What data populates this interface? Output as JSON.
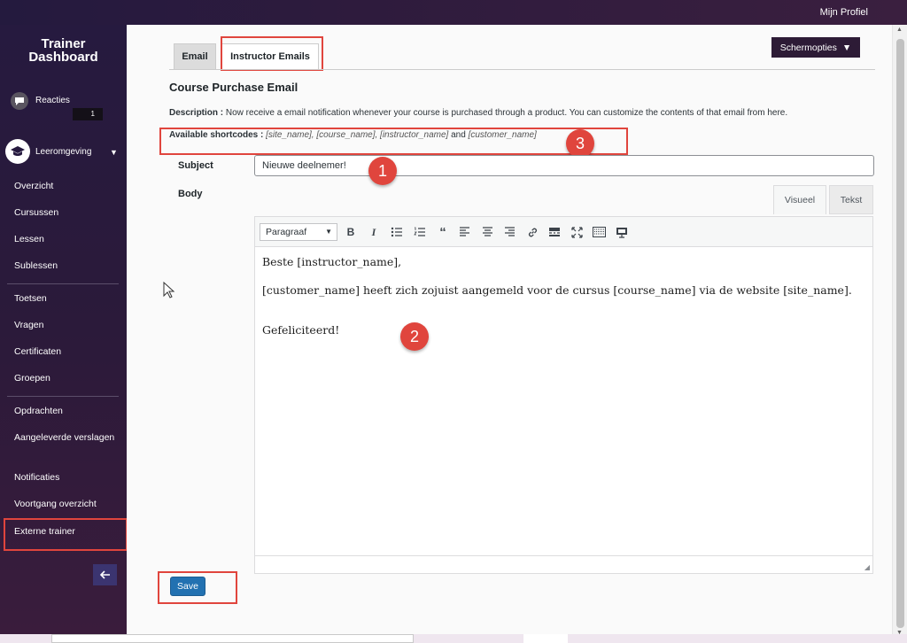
{
  "topbar": {
    "profile_link": "Mijn Profiel"
  },
  "sidebar": {
    "brand_line1": "Trainer",
    "brand_line2": "Dashboard",
    "reacties": {
      "label": "Reacties",
      "badge": "1"
    },
    "leeromgeving": {
      "label": "Leeromgeving"
    },
    "links": [
      "Overzicht",
      "Cursussen",
      "Lessen",
      "Sublessen",
      "Toetsen",
      "Vragen",
      "Certificaten",
      "Groepen",
      "Opdrachten",
      "Aangeleverde verslagen",
      "Notificaties",
      "Voortgang overzicht",
      "Externe trainer"
    ],
    "collapse_icon": "arrow-left-icon"
  },
  "screen_options": {
    "label": "Schermopties"
  },
  "tabs": [
    {
      "label": "Email"
    },
    {
      "label": "Instructor Emails"
    }
  ],
  "section": {
    "title": "Course Purchase Email",
    "description_label": "Description :",
    "description_text": " Now receive a email notification whenever your course is purchased through a product. You can customize the contents of that email from here.",
    "shortcodes_label": "Available shortcodes :",
    "shortcodes_1": " [site_name], [course_name], [instructor_name]",
    "shortcodes_and": " and ",
    "shortcodes_2": "[customer_name]"
  },
  "form": {
    "subject_label": "Subject",
    "subject_value": "Nieuwe deelnemer!",
    "body_label": "Body"
  },
  "editor": {
    "mode_visual": "Visueel",
    "mode_text": "Tekst",
    "format_select": "Paragraaf",
    "lines": [
      "Beste [instructor_name],",
      "[customer_name] heeft zich zojuist aangemeld voor de cursus [course_name] via de website [site_name].",
      "Gefeliciteerd!"
    ]
  },
  "save_button": "Save",
  "callouts": {
    "one": "1",
    "two": "2",
    "three": "3"
  },
  "colors": {
    "highlight": "#e0453d",
    "primary_button": "#2271b1",
    "sidebar_bg": "#261a3f"
  }
}
